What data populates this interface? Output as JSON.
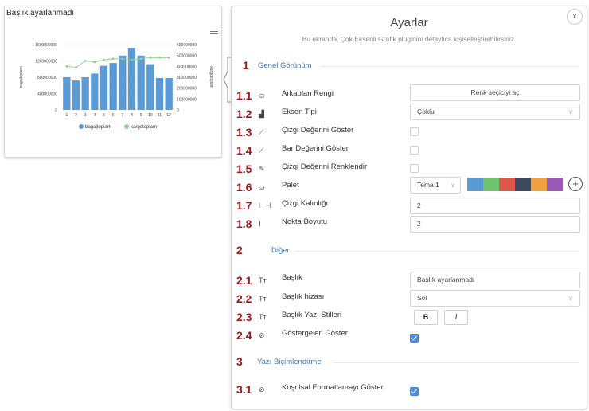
{
  "chart": {
    "title": "Başlık ayarlanmadı",
    "left_axis_label": "bagajtoplam",
    "right_axis_label": "kargotoplam",
    "legend": [
      "bagajtoplam",
      "kargotoplam"
    ]
  },
  "chart_data": {
    "type": "bar",
    "categories": [
      "1",
      "2",
      "3",
      "4",
      "5",
      "6",
      "7",
      "8",
      "9",
      "10",
      "11",
      "12"
    ],
    "series": [
      {
        "name": "bagajtoplam",
        "type": "bar",
        "axis": "left",
        "values": [
          800000000,
          720000000,
          800000000,
          890000000,
          1080000000,
          1150000000,
          1330000000,
          1520000000,
          1330000000,
          1120000000,
          780000000,
          780000000
        ]
      },
      {
        "name": "kargotoplam",
        "type": "line",
        "axis": "right",
        "values": [
          400000000,
          390000000,
          450000000,
          440000000,
          460000000,
          470000000,
          470000000,
          460000000,
          470000000,
          480000000,
          480000000,
          480000000
        ]
      }
    ],
    "ylim_left": [
      0,
      1600000000
    ],
    "yticks_left": [
      "0",
      "400000000",
      "800000000",
      "1200000000",
      "1600000000"
    ],
    "ylim_right": [
      0,
      600000000
    ],
    "yticks_right": [
      "0",
      "100000000",
      "200000000",
      "300000000",
      "400000000",
      "500000000",
      "600000000"
    ],
    "legend_position": "bottom",
    "colors": {
      "bar": "#5b9bd5",
      "line": "#8fd48f"
    }
  },
  "panel": {
    "title": "Ayarlar",
    "subtitle": "Bu ekranda, Çok Eksenli Grafik pluginini detaylıca kişiselleştirebilirsiniz.",
    "close_label": "x",
    "sections": [
      {
        "num": "1",
        "title": "Genel Görünüm"
      },
      {
        "num": "2",
        "title": "Diğer"
      },
      {
        "num": "3",
        "title": "Yazı Biçimlendirme"
      }
    ],
    "rows": {
      "r1_1": {
        "num": "1.1",
        "label": "Arkaplan Rengi",
        "button": "Renk seçiciyi aç",
        "icon": "paint-bucket-icon"
      },
      "r1_2": {
        "num": "1.2",
        "label": "Eksen Tipi",
        "value": "Çoklu",
        "icon": "bar-chart-icon"
      },
      "r1_3": {
        "num": "1.3",
        "label": "Çizgi Değerini Göster",
        "checked": false,
        "icon": "line-chart-icon"
      },
      "r1_4": {
        "num": "1.4",
        "label": "Bar Değerini Göster",
        "checked": false,
        "icon": "line-chart-icon"
      },
      "r1_5": {
        "num": "1.5",
        "label": "Çizgi Değerini Renklendir",
        "checked": false,
        "icon": "brush-icon"
      },
      "r1_6": {
        "num": "1.6",
        "label": "Palet",
        "theme": "Tema 1",
        "icon": "paint-bucket-icon",
        "swatches": [
          "#5b9bd5",
          "#6cc36c",
          "#e0574a",
          "#3a4a5c",
          "#f0a040",
          "#9b59b6"
        ],
        "add_label": "+"
      },
      "r1_7": {
        "num": "1.7",
        "label": "Çizgi Kalınlığı",
        "value": "2",
        "icon": "line-width-icon"
      },
      "r1_8": {
        "num": "1.8",
        "label": "Nokta Boyutu",
        "value": "2",
        "icon": "text-cursor-icon"
      },
      "r2_1": {
        "num": "2.1",
        "label": "Başlık",
        "value": "Başlık ayarlanmadı",
        "icon": "text-size-icon"
      },
      "r2_2": {
        "num": "2.2",
        "label": "Başlık hizası",
        "value": "Sol",
        "icon": "text-size-icon"
      },
      "r2_3": {
        "num": "2.3",
        "label": "Başlık Yazı Stilleri",
        "bold_label": "B",
        "italic_label": "I",
        "icon": "text-size-icon"
      },
      "r2_4": {
        "num": "2.4",
        "label": "Göstergeleri Göster",
        "checked": true,
        "icon": "eye-slash-icon"
      },
      "r3_1": {
        "num": "3.1",
        "label": "Koşulsal Formatlamayı Göster",
        "checked": true,
        "icon": "eye-slash-icon"
      }
    }
  }
}
